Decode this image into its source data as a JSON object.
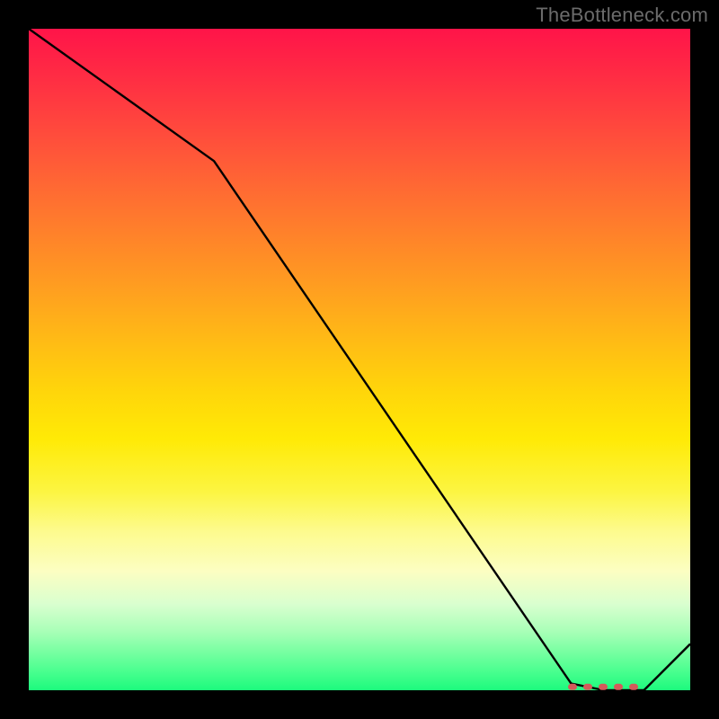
{
  "attribution": "TheBottleneck.com",
  "chart_data": {
    "type": "line",
    "title": "",
    "xlabel": "",
    "ylabel": "",
    "ylim": [
      0,
      100
    ],
    "xlim": [
      0,
      100
    ],
    "x": [
      0,
      28,
      82,
      87,
      93,
      100
    ],
    "values": [
      100,
      80,
      1,
      0,
      0,
      7
    ],
    "annotations": [
      {
        "note": "plateau-marker-segment",
        "x0": 82,
        "x1": 93,
        "y": 0.5
      }
    ]
  },
  "gradient_stops": [
    {
      "pct": 0,
      "color": "#ff1449"
    },
    {
      "pct": 50,
      "color": "#ffd60a"
    },
    {
      "pct": 100,
      "color": "#1dfa7d"
    }
  ]
}
